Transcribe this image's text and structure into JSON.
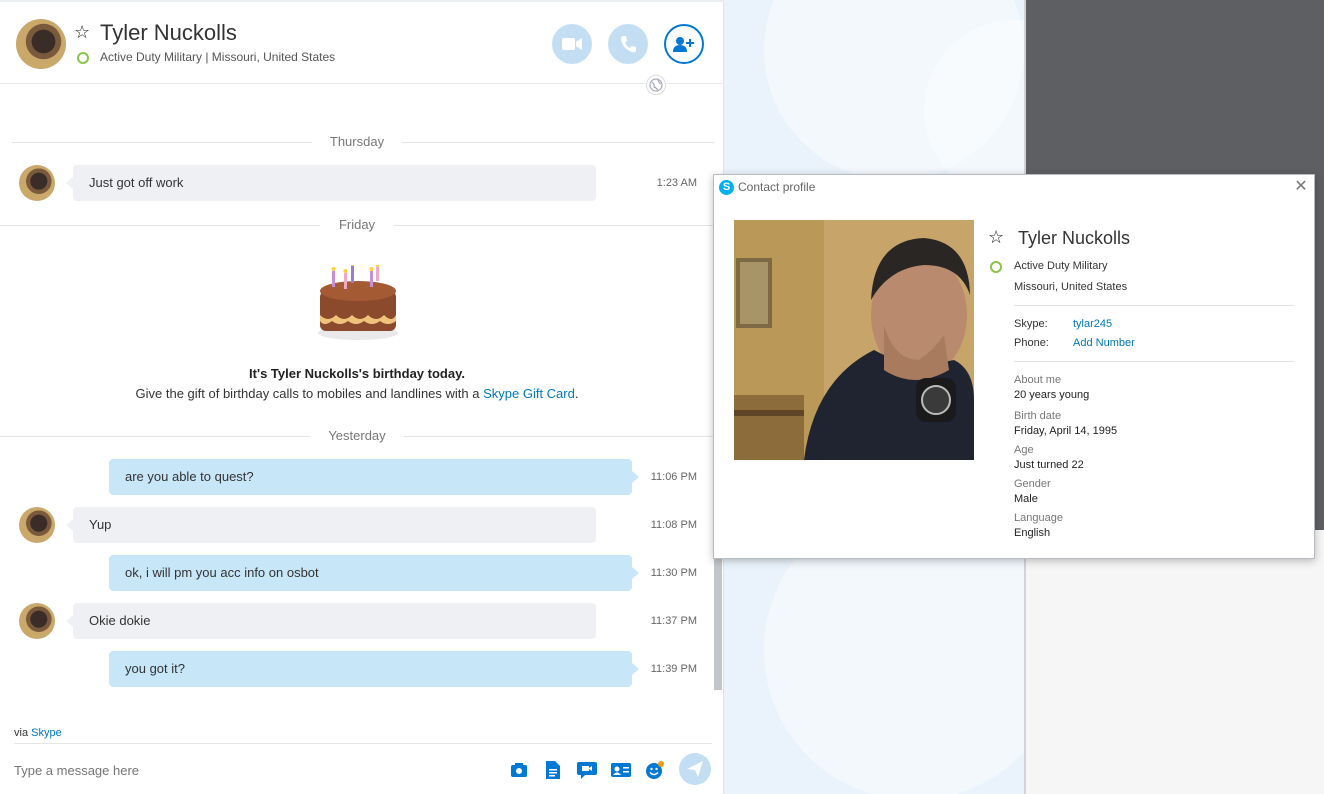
{
  "header": {
    "contact_name": "Tyler Nuckolls",
    "subtitle": "Active Duty Military  |  Missouri, United States"
  },
  "messages": {
    "days": [
      "Thursday",
      "Friday",
      "Yesterday"
    ],
    "items": [
      {
        "direction": "in",
        "text": "Just got off work",
        "time": "1:23 AM"
      },
      {
        "direction": "out",
        "text": "are you able to quest?",
        "time": "11:06 PM"
      },
      {
        "direction": "in",
        "text": "Yup",
        "time": "11:08 PM"
      },
      {
        "direction": "out",
        "text": "ok, i will pm you acc info on osbot",
        "time": "11:30 PM"
      },
      {
        "direction": "in",
        "text": "Okie dokie",
        "time": "11:37 PM"
      },
      {
        "direction": "out",
        "text": "you got it?",
        "time": "11:39 PM"
      }
    ]
  },
  "birthday": {
    "title": "It's Tyler Nuckolls's birthday today.",
    "text_prefix": "Give the gift of birthday calls to mobiles and landlines with a ",
    "link": "Skype Gift Card",
    "text_suffix": "."
  },
  "footer": {
    "via_prefix": "via ",
    "via_link": "Skype",
    "compose_placeholder": "Type a message here"
  },
  "profile": {
    "window_title": "Contact profile",
    "name": "Tyler Nuckolls",
    "status": "Active Duty Military",
    "location": "Missouri, United States",
    "skype_label": "Skype:",
    "skype_value": "tylar245",
    "phone_label": "Phone:",
    "phone_value": "Add Number",
    "about_label": "About me",
    "about_value": "20 years young",
    "birth_label": "Birth date",
    "birth_value": "Friday, April 14, 1995",
    "age_label": "Age",
    "age_value": "Just turned 22",
    "gender_label": "Gender",
    "gender_value": "Male",
    "language_label": "Language",
    "language_value": "English"
  },
  "icons": {
    "video": "video-camera-icon",
    "call": "phone-icon",
    "add_people": "add-people-icon",
    "send": "send-icon"
  },
  "colors": {
    "accent": "#0078d4",
    "outgoing_bubble": "#c7e6f8",
    "incoming_bubble": "#eef0f3",
    "online": "#8bc34a"
  }
}
